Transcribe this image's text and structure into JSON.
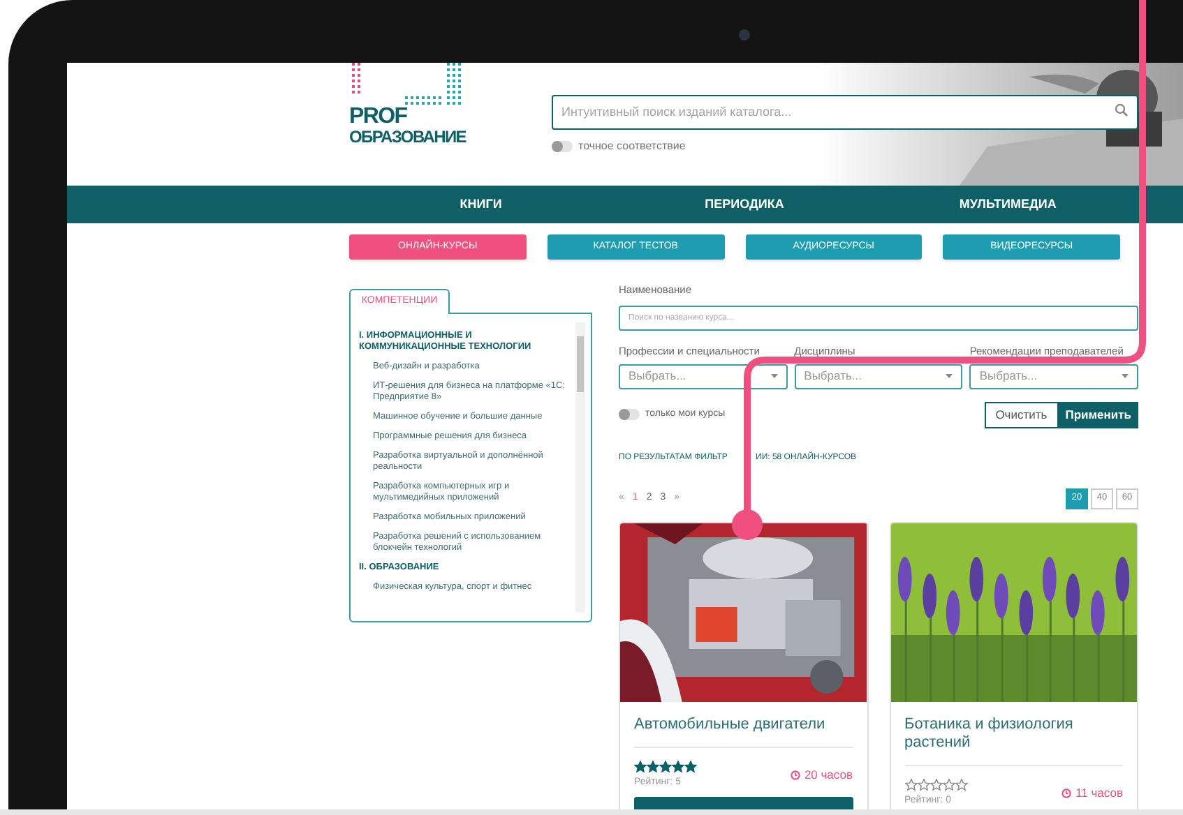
{
  "logo": {
    "line1": "PROF",
    "line2": "ОБРАЗОВАНИЕ"
  },
  "search": {
    "placeholder": "Интуитивный поиск изданий каталога...",
    "exact_match": {
      "label": "точное соответствие",
      "on": false
    }
  },
  "nav": [
    "КНИГИ",
    "ПЕРИОДИКА",
    "МУЛЬТИМЕДИА"
  ],
  "sections": [
    {
      "label": "ОНЛАЙН-КУРСЫ",
      "selected": true
    },
    {
      "label": "КАТАЛОГ ТЕСТОВ",
      "selected": false
    },
    {
      "label": "АУДИОРЕСУРСЫ",
      "selected": false
    },
    {
      "label": "ВИДЕОРЕСУРСЫ",
      "selected": false
    }
  ],
  "sidebar": {
    "tab": "КОМПЕТЕНЦИИ",
    "groups": [
      {
        "title": "I. ИНФОРМАЦИОННЫЕ И КОММУНИКАЦИОННЫЕ ТЕХНОЛОГИИ",
        "items": [
          "Веб-дизайн и разработка",
          "ИТ-решения для бизнеса на платформе «1С: Предприятие 8»",
          "Машинное обучение и большие данные",
          "Программные решения для бизнеса",
          "Разработка виртуальной и дополнённой реальности",
          "Разработка компьютерных игр и мультимедийных приложений",
          "Разработка мобильных приложений",
          "Разработка решений с использованием блокчейн технологий"
        ]
      },
      {
        "title": "II. ОБРАЗОВАНИЕ",
        "items": [
          "Физическая культура, спорт и фитнес"
        ]
      }
    ]
  },
  "filters": {
    "name_label": "Наименование",
    "name_placeholder": "Поиск по названию курса...",
    "selects": [
      {
        "label": "Профессии и специальности",
        "placeholder": "Выбрать..."
      },
      {
        "label": "Дисциплины",
        "placeholder": "Выбрать..."
      },
      {
        "label": "Рекомендации преподавателей",
        "placeholder": "Выбрать..."
      }
    ],
    "my_courses": {
      "label": "только мои курсы",
      "on": false
    },
    "clear": "Очистить",
    "apply": "Применить"
  },
  "results": {
    "before_line": "ПО РЕЗУЛЬТАТАМ ФИЛЬТР",
    "after_line": "ИИ: 58 ОНЛАЙН-КУРСОВ"
  },
  "pagination": {
    "prev": "«",
    "pages": [
      {
        "label": "1",
        "selected": true
      },
      {
        "label": "2",
        "selected": false
      },
      {
        "label": "3",
        "selected": false
      }
    ],
    "next": "»"
  },
  "page_sizes": [
    {
      "label": "20",
      "selected": true
    },
    {
      "label": "40",
      "selected": false
    },
    {
      "label": "60",
      "selected": false
    }
  ],
  "courses": [
    {
      "kind": "engine",
      "title": "Автомобильные двигатели",
      "stars": 5,
      "rating": "Рейтинг: 5",
      "duration": "20 часов"
    },
    {
      "kind": "flowers",
      "title": "Ботаника и физиология растений",
      "stars": 0,
      "rating": "Рейтинг: 0",
      "duration": "11 часов"
    }
  ]
}
